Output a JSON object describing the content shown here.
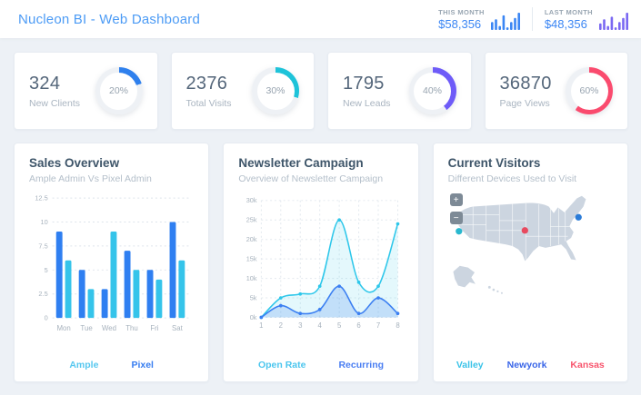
{
  "header": {
    "title": "Nucleon BI - Web Dashboard",
    "stats": [
      {
        "label": "THIS MONTH",
        "value": "$58,356",
        "color": "#3b86f4",
        "spark": [
          6,
          8,
          3,
          11,
          2,
          6,
          9,
          13
        ]
      },
      {
        "label": "LAST MONTH",
        "value": "$48,356",
        "color": "#7a68f2",
        "spark": [
          5,
          8,
          3,
          10,
          2,
          6,
          9,
          13
        ]
      }
    ]
  },
  "stat_cards": [
    {
      "value": "324",
      "label": "New Clients",
      "percent": 20,
      "percent_label": "20%",
      "color": "#2f80ed"
    },
    {
      "value": "2376",
      "label": "Total Visits",
      "percent": 30,
      "percent_label": "30%",
      "color": "#1ec3d9"
    },
    {
      "value": "1795",
      "label": "New Leads",
      "percent": 40,
      "percent_label": "40%",
      "color": "#6e5bf8"
    },
    {
      "value": "36870",
      "label": "Page Views",
      "percent": 60,
      "percent_label": "60%",
      "color": "#fa4b6e"
    }
  ],
  "sales": {
    "title": "Sales Overview",
    "subtitle": "Ample Admin Vs Pixel Admin",
    "chart_data": {
      "type": "bar",
      "categories": [
        "Mon",
        "Tue",
        "Wed",
        "Thu",
        "Fri",
        "Sat"
      ],
      "series": [
        {
          "name": "Pixel",
          "color": "#2f7ff1",
          "values": [
            9,
            5,
            3,
            7,
            5,
            10
          ]
        },
        {
          "name": "Ample",
          "color": "#35c4ea",
          "values": [
            6,
            3,
            9,
            5,
            4,
            6
          ]
        }
      ],
      "ylim": [
        0,
        12.5
      ],
      "yticks": [
        0,
        2.5,
        5,
        7.5,
        10,
        12.5
      ],
      "grid": "dashed-horizontal",
      "legend_position": "bottom"
    },
    "legend": [
      {
        "label": "Ample",
        "color": "#56c7ef"
      },
      {
        "label": "Pixel",
        "color": "#377df0"
      }
    ]
  },
  "newsletter": {
    "title": "Newsletter Campaign",
    "subtitle": "Overview of Newsletter Campaign",
    "chart_data": {
      "type": "line",
      "x": [
        1,
        2,
        3,
        4,
        5,
        6,
        7,
        8
      ],
      "series": [
        {
          "name": "Open Rate",
          "color": "#2ec7ea",
          "fill": "rgba(46,199,234,0.13)",
          "values": [
            0,
            5,
            6,
            8,
            25,
            9,
            8,
            24
          ]
        },
        {
          "name": "Recurring",
          "color": "#3b7ff2",
          "fill": "rgba(59,127,242,0.20)",
          "values": [
            0,
            3,
            1,
            2,
            8,
            1,
            5,
            1
          ]
        }
      ],
      "ylim": [
        0,
        30
      ],
      "yticks": [
        "0k",
        "5k",
        "10k",
        "15k",
        "20k",
        "25k",
        "30k"
      ],
      "grid": "dashed-both",
      "smooth": true,
      "area": true,
      "legend_position": "bottom"
    },
    "legend": [
      {
        "label": "Open Rate",
        "color": "#4cc6ee"
      },
      {
        "label": "Recurring",
        "color": "#4a7ef2"
      }
    ]
  },
  "visitors": {
    "title": "Current Visitors",
    "subtitle": "Different Devices Used to Visit",
    "zoom_in_label": "+",
    "zoom_out_label": "−",
    "markers": [
      {
        "label": "Valley",
        "color": "#29b8cf",
        "x": 13,
        "y": 46
      },
      {
        "label": "Kansas",
        "color": "#e84a5f",
        "x": 93,
        "y": 45
      },
      {
        "label": "Newyork",
        "color": "#2b7cd8",
        "x": 158,
        "y": 29
      }
    ],
    "legend": [
      {
        "label": "Valley",
        "color": "#3bc3e8"
      },
      {
        "label": "Newyork",
        "color": "#3a66e8"
      },
      {
        "label": "Kansas",
        "color": "#f8566e"
      }
    ]
  }
}
